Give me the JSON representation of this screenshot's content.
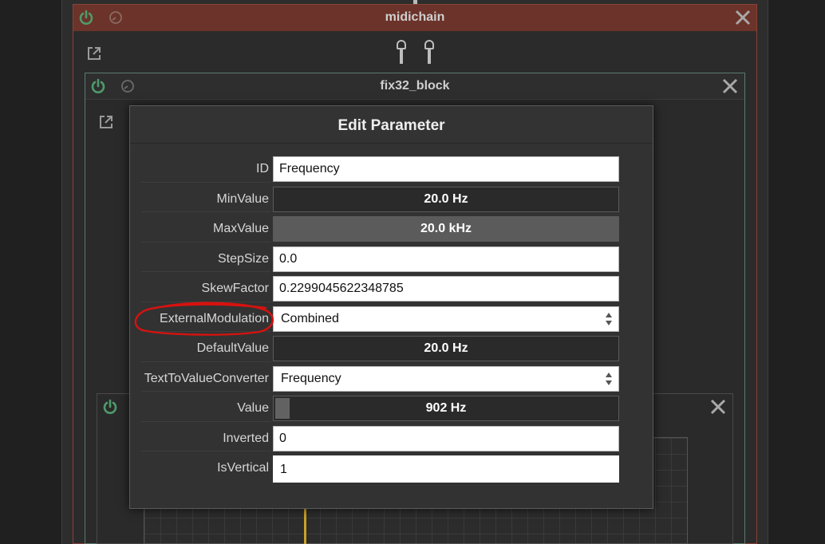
{
  "midichain": {
    "title": "midichain"
  },
  "fix32_block": {
    "title": "fix32_block"
  },
  "dialog": {
    "title": "Edit Parameter",
    "rows": {
      "id": {
        "label": "ID",
        "value": "Frequency"
      },
      "min_value": {
        "label": "MinValue",
        "value": "20.0 Hz"
      },
      "max_value": {
        "label": "MaxValue",
        "value": "20.0 kHz"
      },
      "step_size": {
        "label": "StepSize",
        "value": "0.0"
      },
      "skew_factor": {
        "label": "SkewFactor",
        "value": "0.2299045622348785"
      },
      "external_modulation": {
        "label": "ExternalModulation",
        "value": "Combined"
      },
      "default_value": {
        "label": "DefaultValue",
        "value": "20.0 Hz"
      },
      "text_to_value_converter": {
        "label": "TextToValueConverter",
        "value": "Frequency"
      },
      "value": {
        "label": "Value",
        "value": "902 Hz",
        "fill_fraction": 0.04
      },
      "inverted": {
        "label": "Inverted",
        "value": "0"
      },
      "is_vertical": {
        "label": "IsVertical",
        "value": "1"
      }
    }
  },
  "colors": {
    "power_on": "#4f9a6b",
    "annotation_circle": "#d7120f",
    "midichain_border": "#8a4236",
    "fix32_border": "#5c7a6e"
  },
  "icons": [
    "power-icon",
    "bypass-icon",
    "close-icon",
    "popout-icon",
    "updown-arrows-icon"
  ]
}
